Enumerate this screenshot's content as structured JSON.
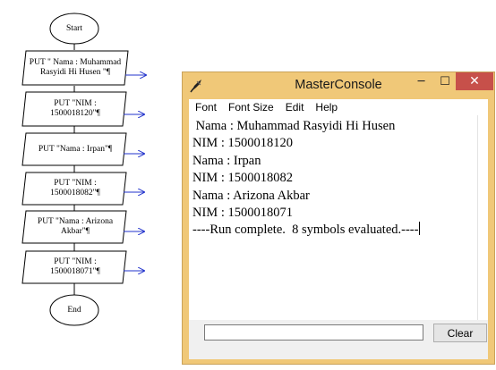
{
  "flowchart": {
    "start_label": "Start",
    "end_label": "End",
    "steps": [
      "PUT \" Nama : Muhammad Rasyidi Hi Husen \"¶",
      "PUT \"NIM : 1500018120\"¶",
      "PUT \"Nama : Irpan\"¶",
      "PUT \"NIM : 1500018082\"¶",
      "PUT \"Nama : Arizona Akbar\"¶",
      "PUT \"NIM : 1500018071\"¶"
    ],
    "colors": {
      "shape_stroke": "#000000",
      "arrow": "#2233cc"
    }
  },
  "window": {
    "title": "MasterConsole",
    "app_icon": "pen-icon",
    "controls": {
      "minimize": "─",
      "maximize": "☐",
      "close": "✕"
    },
    "menu": [
      "Font",
      "Font Size",
      "Edit",
      "Help"
    ],
    "console_lines": [
      " Nama : Muhammad Rasyidi Hi Husen",
      "NIM : 1500018120",
      "Nama : Irpan",
      "NIM : 1500018082",
      "Nama : Arizona Akbar",
      "NIM : 1500018071",
      "----Run complete.  8 symbols evaluated.----"
    ],
    "command_input_value": "",
    "clear_label": "Clear",
    "colors": {
      "frame": "#f0c878",
      "close_button": "#c7504a"
    }
  }
}
